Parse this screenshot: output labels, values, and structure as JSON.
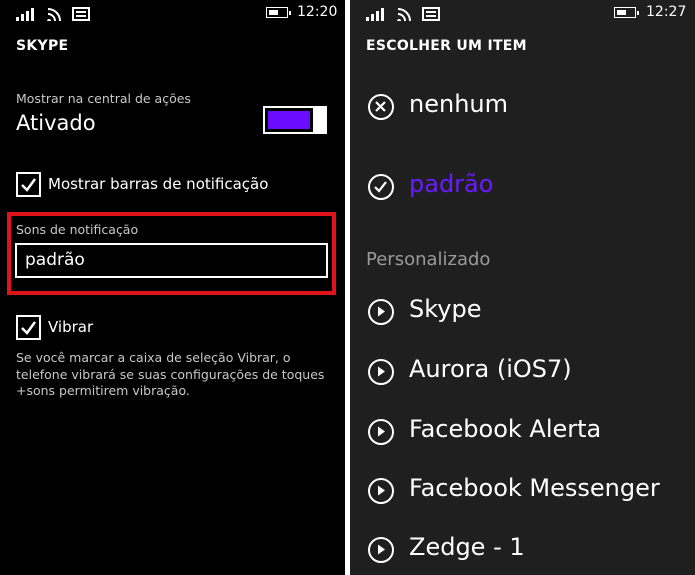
{
  "left_screen": {
    "status": {
      "time": "12:20"
    },
    "title": "SKYPE",
    "action_center": {
      "label": "Mostrar na central de ações",
      "state": "Ativado",
      "enabled": true
    },
    "show_banners": {
      "label": "Mostrar barras de notificação",
      "checked": true
    },
    "sound": {
      "label": "Sons de notificação",
      "value": "padrão"
    },
    "vibrate": {
      "label": "Vibrar",
      "checked": true
    },
    "help_text": "Se você marcar a caixa de seleção Vibrar, o telefone vibrará se suas configurações de toques +sons permitirem vibração."
  },
  "right_screen": {
    "status": {
      "time": "12:27"
    },
    "title": "ESCOLHER UM ITEM",
    "items": [
      {
        "label": "nenhum",
        "icon": "close-circle-icon"
      },
      {
        "label": "padrão",
        "icon": "check-circle-icon",
        "selected": true
      }
    ],
    "section_header": "Personalizado",
    "custom_items": [
      {
        "label": "Skype",
        "icon": "play-circle-icon"
      },
      {
        "label": "Aurora (iOS7)",
        "icon": "play-circle-icon"
      },
      {
        "label": "Facebook Alerta",
        "icon": "play-circle-icon"
      },
      {
        "label": "Facebook Messenger",
        "icon": "play-circle-icon"
      },
      {
        "label": "Zedge - 1",
        "icon": "play-circle-icon"
      }
    ]
  },
  "colors": {
    "accent": "#6a1bff",
    "highlight": "#e0121a",
    "left_bg": "#000000",
    "right_bg": "#1f1f1f"
  }
}
